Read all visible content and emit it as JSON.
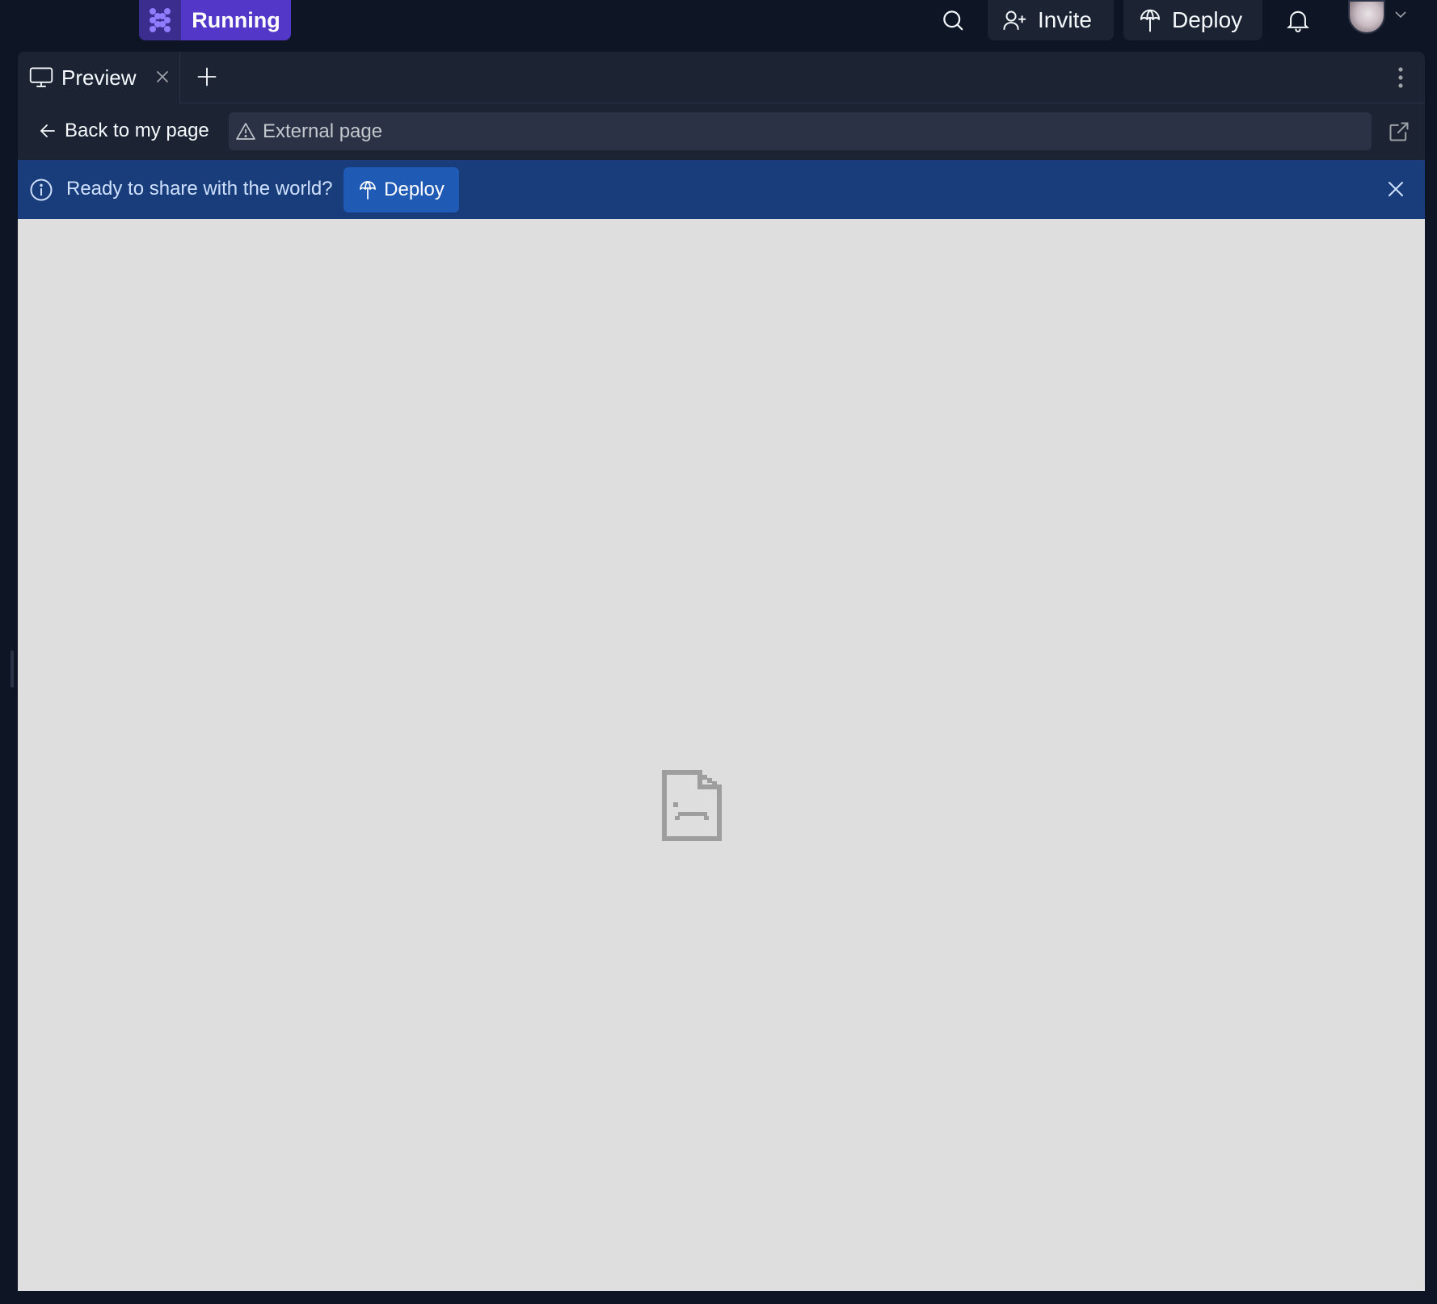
{
  "topbar": {
    "run_label": "Running",
    "invite_label": "Invite",
    "deploy_label": "Deploy",
    "icons": [
      "search-icon",
      "add-user-icon",
      "deploy-icon",
      "bell-icon",
      "chevron-down-icon"
    ]
  },
  "tabs": [
    {
      "label": "Preview",
      "icon": "monitor-icon"
    }
  ],
  "preview": {
    "back_label": "Back to my page",
    "url_text": "External page",
    "banner_message": "Ready to share with the world?",
    "banner_button": "Deploy"
  },
  "colors": {
    "app_bg": "#0e1525",
    "panel_bg": "#1c2333",
    "accent_purple": "#5237c9",
    "banner_bg": "#183d7a",
    "banner_button": "#1f5ab5",
    "viewport_bg": "#dedede"
  }
}
